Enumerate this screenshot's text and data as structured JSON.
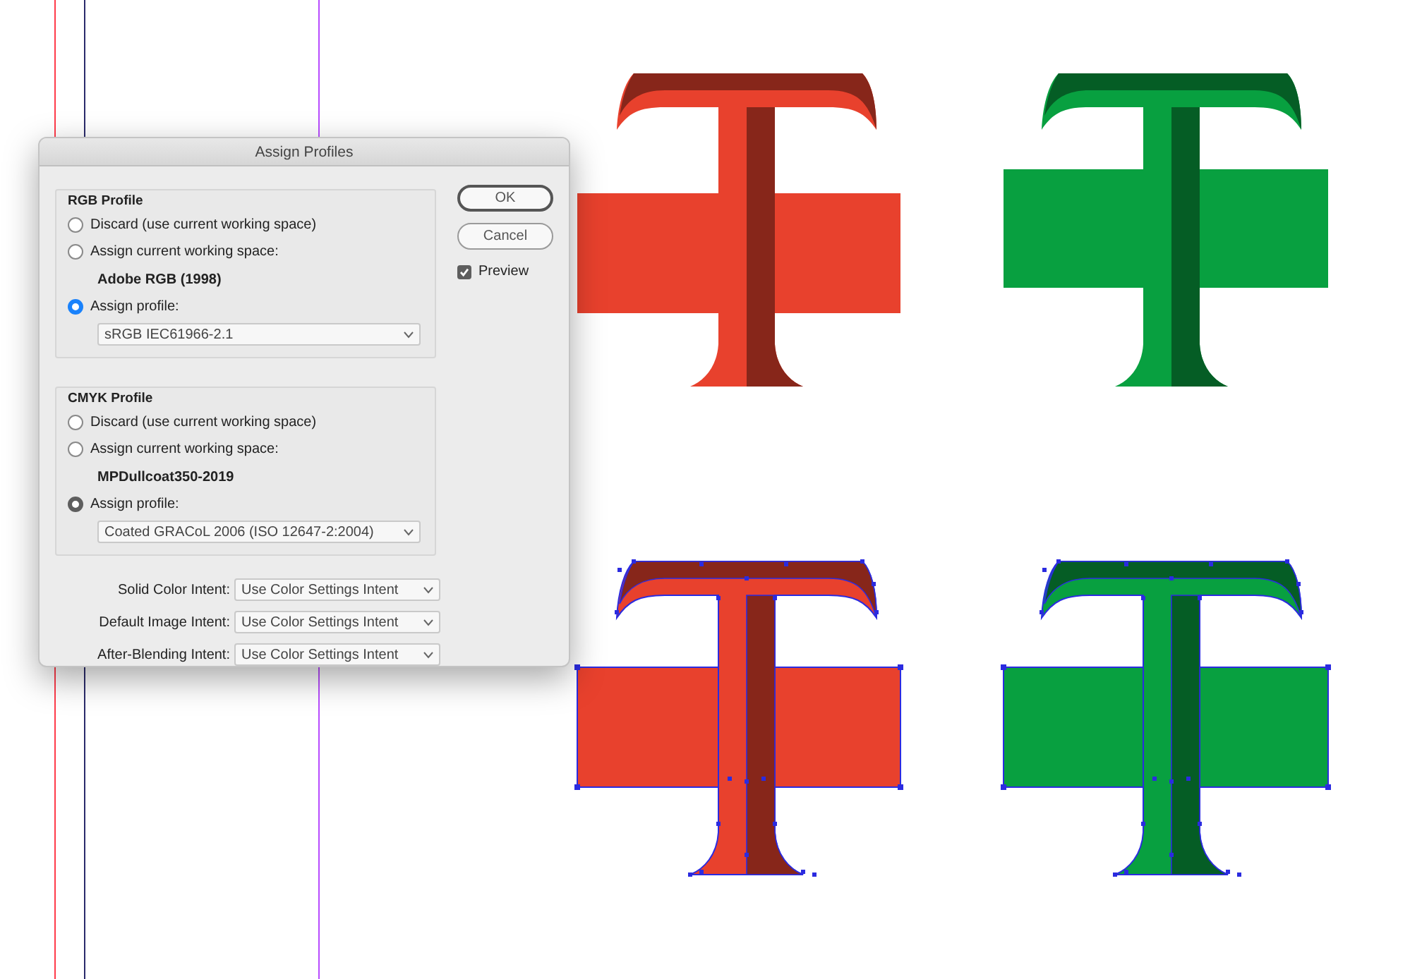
{
  "window": {
    "title": "Assign Profiles"
  },
  "groups": [
    {
      "legend": "RGB Profile",
      "focused": true,
      "options": [
        {
          "label": "Discard (use current working space)",
          "selected": false
        },
        {
          "label": "Assign current working space:",
          "selected": false,
          "detail": "Adobe RGB (1998)"
        },
        {
          "label": "Assign profile:",
          "selected": true
        }
      ],
      "profile": "sRGB IEC61966-2.1"
    },
    {
      "legend": "CMYK Profile",
      "focused": false,
      "options": [
        {
          "label": "Discard (use current working space)",
          "selected": false
        },
        {
          "label": "Assign current working space:",
          "selected": false,
          "detail": "MPDullcoat350-2019"
        },
        {
          "label": "Assign profile:",
          "selected": true
        }
      ],
      "profile": "Coated GRACoL 2006 (ISO 12647-2:2004)"
    }
  ],
  "intents": [
    {
      "label": "Solid Color Intent:",
      "value": "Use Color Settings Intent"
    },
    {
      "label": "Default Image Intent:",
      "value": "Use Color Settings Intent"
    },
    {
      "label": "After-Blending Intent:",
      "value": "Use Color Settings Intent"
    }
  ],
  "buttons": [
    {
      "label": "OK",
      "default": true
    },
    {
      "label": "Cancel",
      "default": false
    }
  ],
  "preview": {
    "label": "Preview",
    "checked": true
  },
  "artwork": [
    {
      "color": "#e8412d",
      "selected": false
    },
    {
      "color": "#08a040",
      "selected": false
    },
    {
      "color": "#e8412d",
      "selected": true
    },
    {
      "color": "#08a040",
      "selected": true
    }
  ]
}
